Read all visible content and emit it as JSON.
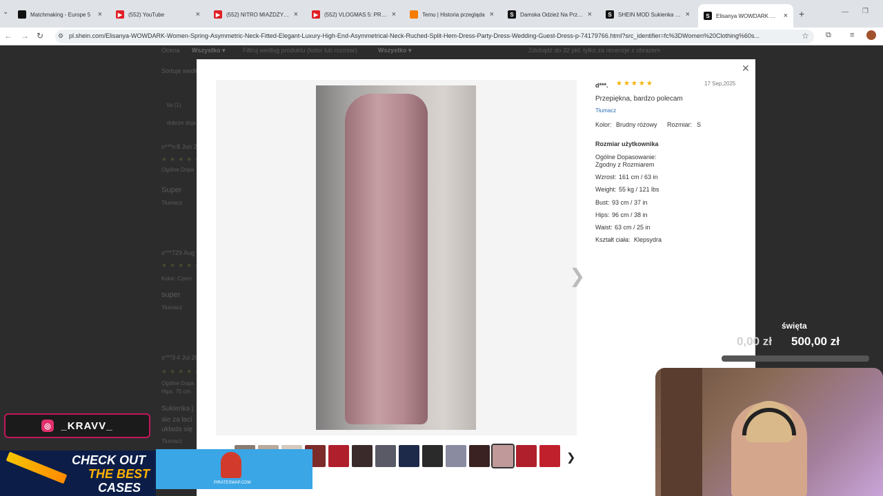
{
  "tabs": [
    {
      "title": "Matchmaking - Europe 5",
      "color": "#111111",
      "glyph": ""
    },
    {
      "title": "(552) YouTube",
      "color": "#e01f26",
      "glyph": "▶"
    },
    {
      "title": "(552) NITRO MIAŻDŻY M",
      "color": "#e01f26",
      "glyph": "▶"
    },
    {
      "title": "(552) VLOGMAS 5: PRZYG",
      "color": "#e01f26",
      "glyph": "▶"
    },
    {
      "title": "Temu | Historia przegląda",
      "color": "#f57c00",
      "glyph": ""
    },
    {
      "title": "Damska Odzież Na Przyję",
      "color": "#111111",
      "glyph": "S"
    },
    {
      "title": "SHEIN MOD Sukienka da",
      "color": "#111111",
      "glyph": "S"
    },
    {
      "title": "Elisanya WOWDARK Dam",
      "color": "#111111",
      "glyph": "S"
    }
  ],
  "new_tab": "+",
  "url": "pl.shein.com/Elisanya-WOWDARK-Women-Spring-Asymmetric-Neck-Fitted-Elegant-Luxury-High-End-Asymmetrical-Neck-Ruched-Split-Hem-Dress-Party-Dress-Wedding-Guest-Dress-p-74179766.html?src_identifier=fc%3DWomen%20Clothing%60s...",
  "background": {
    "filter1_label": "Ocena",
    "filter1_value": "Wszystko ▾",
    "filter2_label": "Filtruj według produktu (kolor lub rozmiar)",
    "filter2_value": "Wszystko ▾",
    "note": "Zdobądź do 32 pkt. tylko za recenzje z obrazem",
    "sort": "Sortuje według",
    "r1_user": "o***n",
    "r1_date": "8 Jun 20",
    "r1_text": "Super",
    "r1_translate": "Tłumacz",
    "r2_user": "s***7",
    "r2_date": "29 Aug",
    "r2_text": "super",
    "r2_translate": "Tłumacz",
    "r3_user": "s***3",
    "r3_date": "4 Jul 20",
    "r3_text": "Sukienka j",
    "r3_text2": "ale za łaci",
    "r3_text3": "układa się",
    "r3_translate": "Tłumacz"
  },
  "review": {
    "user": "d***.",
    "stars": "★★★★★",
    "date": "17 Sep,2025",
    "text": "Przepiękna, bardzo polecam",
    "translate": "Tłumacz",
    "color_label": "Kolor:",
    "color_value": "Brudny różowy",
    "size_label": "Rozmiar:",
    "size_value": "S",
    "user_size_title": "Rozmiar użytkownika",
    "fit_label": "Ogólne Dopasowanie:",
    "fit_value": "Zgodny z Rozmiarem",
    "height_label": "Wzrost:",
    "height_value": "161 cm / 63 in",
    "weight_label": "Weight:",
    "weight_value": "55 kg / 121 lbs",
    "bust_label": "Bust:",
    "bust_value": "93 cm / 37 in",
    "hips_label": "Hips:",
    "hips_value": "96 cm / 38 in",
    "waist_label": "Waist:",
    "waist_value": "63 cm / 25 in",
    "body_label": "Kształt ciała:",
    "body_value": "Klepsydra"
  },
  "thumb_colors": [
    "#8a7b70",
    "#b8a99a",
    "#d5c9bd",
    "#7d2a2a",
    "#b01f2c",
    "#3a2a2a",
    "#5a5a66",
    "#1e2a4a",
    "#2a2a2a",
    "#8a8aa0",
    "#3a2222",
    "#c09a9a",
    "#b01f2c",
    "#c0202c"
  ],
  "overlay": {
    "social_handle": "_KRAVV_",
    "ad_line1": "CHECK OUT",
    "ad_line2": "THE BEST",
    "ad_line3": "CASES",
    "ad2_brand": "PIRATESWAP.COM",
    "goal_name": "święta",
    "goal_current": "0,00 zł",
    "goal_target": "500,00 zł",
    "goal_progress": 0
  }
}
